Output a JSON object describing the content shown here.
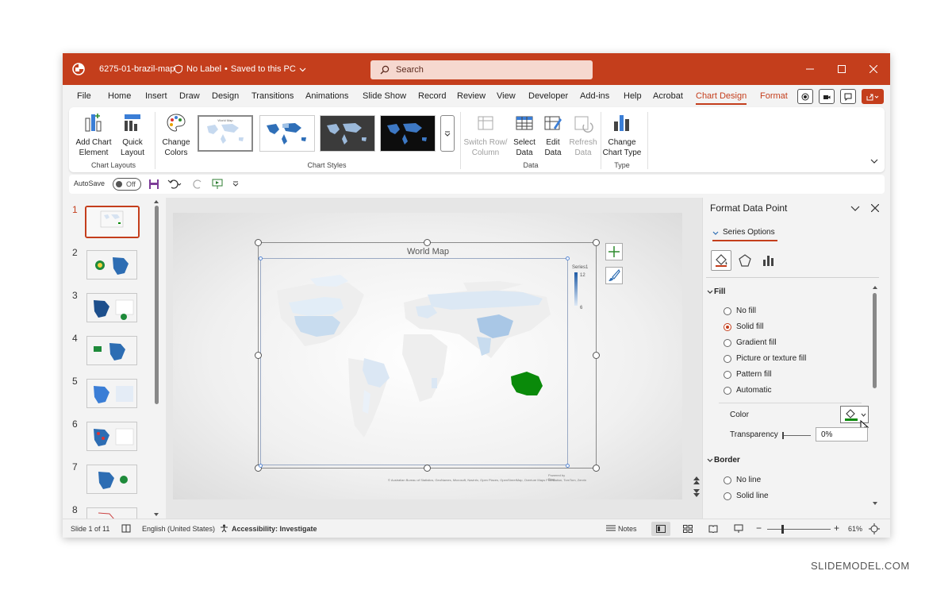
{
  "window": {
    "file_name": "6275-01-brazil-map",
    "label_status": "No Label",
    "save_status": "Saved to this PC",
    "search_placeholder": "Search"
  },
  "menu_tabs": [
    "File",
    "Home",
    "Insert",
    "Draw",
    "Design",
    "Transitions",
    "Animations",
    "Slide Show",
    "Record",
    "Review",
    "View",
    "Developer",
    "Add-ins",
    "Help",
    "Acrobat",
    "Chart Design",
    "Format"
  ],
  "active_tab": "Chart Design",
  "ribbon": {
    "add_chart_element": "Add Chart Element",
    "quick_layout": "Quick Layout",
    "group_chart_layouts": "Chart Layouts",
    "change_colors": "Change Colors",
    "group_chart_styles": "Chart Styles",
    "switch_row_column": "Switch Row/ Column",
    "select_data": "Select Data",
    "edit_data": "Edit Data",
    "refresh_data": "Refresh Data",
    "group_data": "Data",
    "change_chart_type": "Change Chart Type",
    "group_type": "Type"
  },
  "qat": {
    "autosave_label": "AutoSave",
    "autosave_state": "Off"
  },
  "slides": {
    "numbers": [
      "1",
      "2",
      "3",
      "4",
      "5",
      "6",
      "7",
      "8"
    ],
    "active": "1"
  },
  "chart": {
    "title": "World Map",
    "legend_series": "Series1",
    "legend_max": "12",
    "legend_min": "6",
    "attribution": "© Australian Bureau of Statistics, GeoNames, Microsoft, Navinfo, Open Places, OpenStreetMap, Overture Maps Foundation, TomTom, Zenrin",
    "powered_by": "Powered by Bing"
  },
  "format_pane": {
    "title": "Format Data Point",
    "tab": "Series Options",
    "fill_section": "Fill",
    "fill_options": [
      "No fill",
      "Solid fill",
      "Gradient fill",
      "Picture or texture fill",
      "Pattern fill",
      "Automatic"
    ],
    "fill_selected": "Solid fill",
    "color_label": "Color",
    "color_value": "#0a8a0a",
    "transparency_label": "Transparency",
    "transparency_value": "0%",
    "border_section": "Border",
    "border_options": [
      "No line",
      "Solid line"
    ]
  },
  "statusbar": {
    "slide_info": "Slide 1 of 11",
    "language": "English (United States)",
    "accessibility": "Accessibility: Investigate",
    "notes": "Notes",
    "zoom": "61%"
  },
  "watermark": "SLIDEMODEL.COM",
  "colors": {
    "accent": "#c43e1c",
    "highlight_country": "#0a8a0a"
  }
}
